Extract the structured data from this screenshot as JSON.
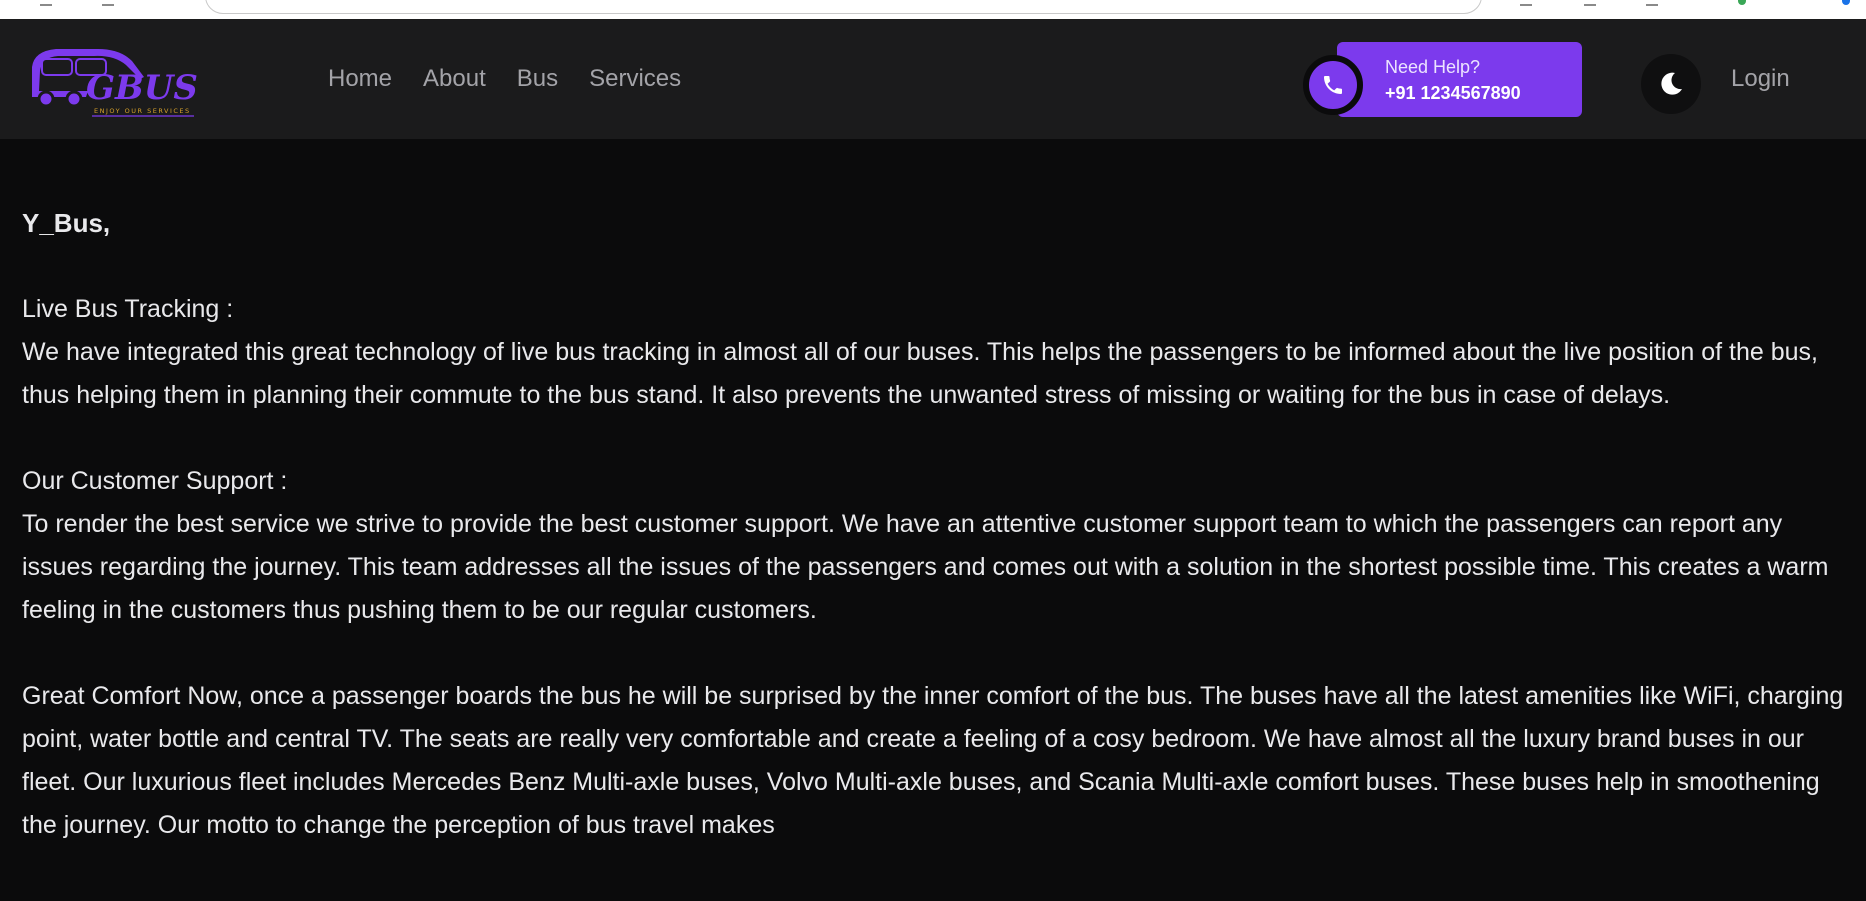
{
  "nav": {
    "logo_text": "GBUS",
    "logo_tagline": "ENJOY OUR SERVICES",
    "links": [
      "Home",
      "About",
      "Bus",
      "Services"
    ],
    "help_title": "Need Help?",
    "help_number": "+91 1234567890",
    "login_label": "Login",
    "accent_color": "#7c3aed"
  },
  "content": {
    "greeting": "Y_Bus,",
    "tracking_heading": "Live Bus Tracking :",
    "tracking_body": "We have integrated this great technology of live bus tracking in almost all of our buses. This helps the passengers to be informed about the live position of the bus, thus helping them in planning their commute to the bus stand. It also prevents the unwanted stress of missing or waiting for the bus in case of delays.",
    "support_heading": "Our Customer Support :",
    "support_body": "To render the best service we strive to provide the best customer support. We have an attentive customer support team to which the passengers can report any issues regarding the journey. This team addresses all the issues of the passengers and comes out with a solution in the shortest possible time. This creates a warm feeling in the customers thus pushing them to be our regular customers.",
    "comfort_body": "Great Comfort Now, once a passenger boards the bus he will be surprised by the inner comfort of the bus. The buses have all the latest amenities like WiFi, charging point, water bottle and central TV. The seats are really very comfortable and create a feeling of a cosy bedroom. We have almost all the luxury brand buses in our fleet. Our luxurious fleet includes Mercedes Benz Multi-axle buses, Volvo Multi-axle buses, and Scania Multi-axle comfort buses. These buses help in smoothening the journey. Our motto to change the perception of bus travel makes"
  }
}
